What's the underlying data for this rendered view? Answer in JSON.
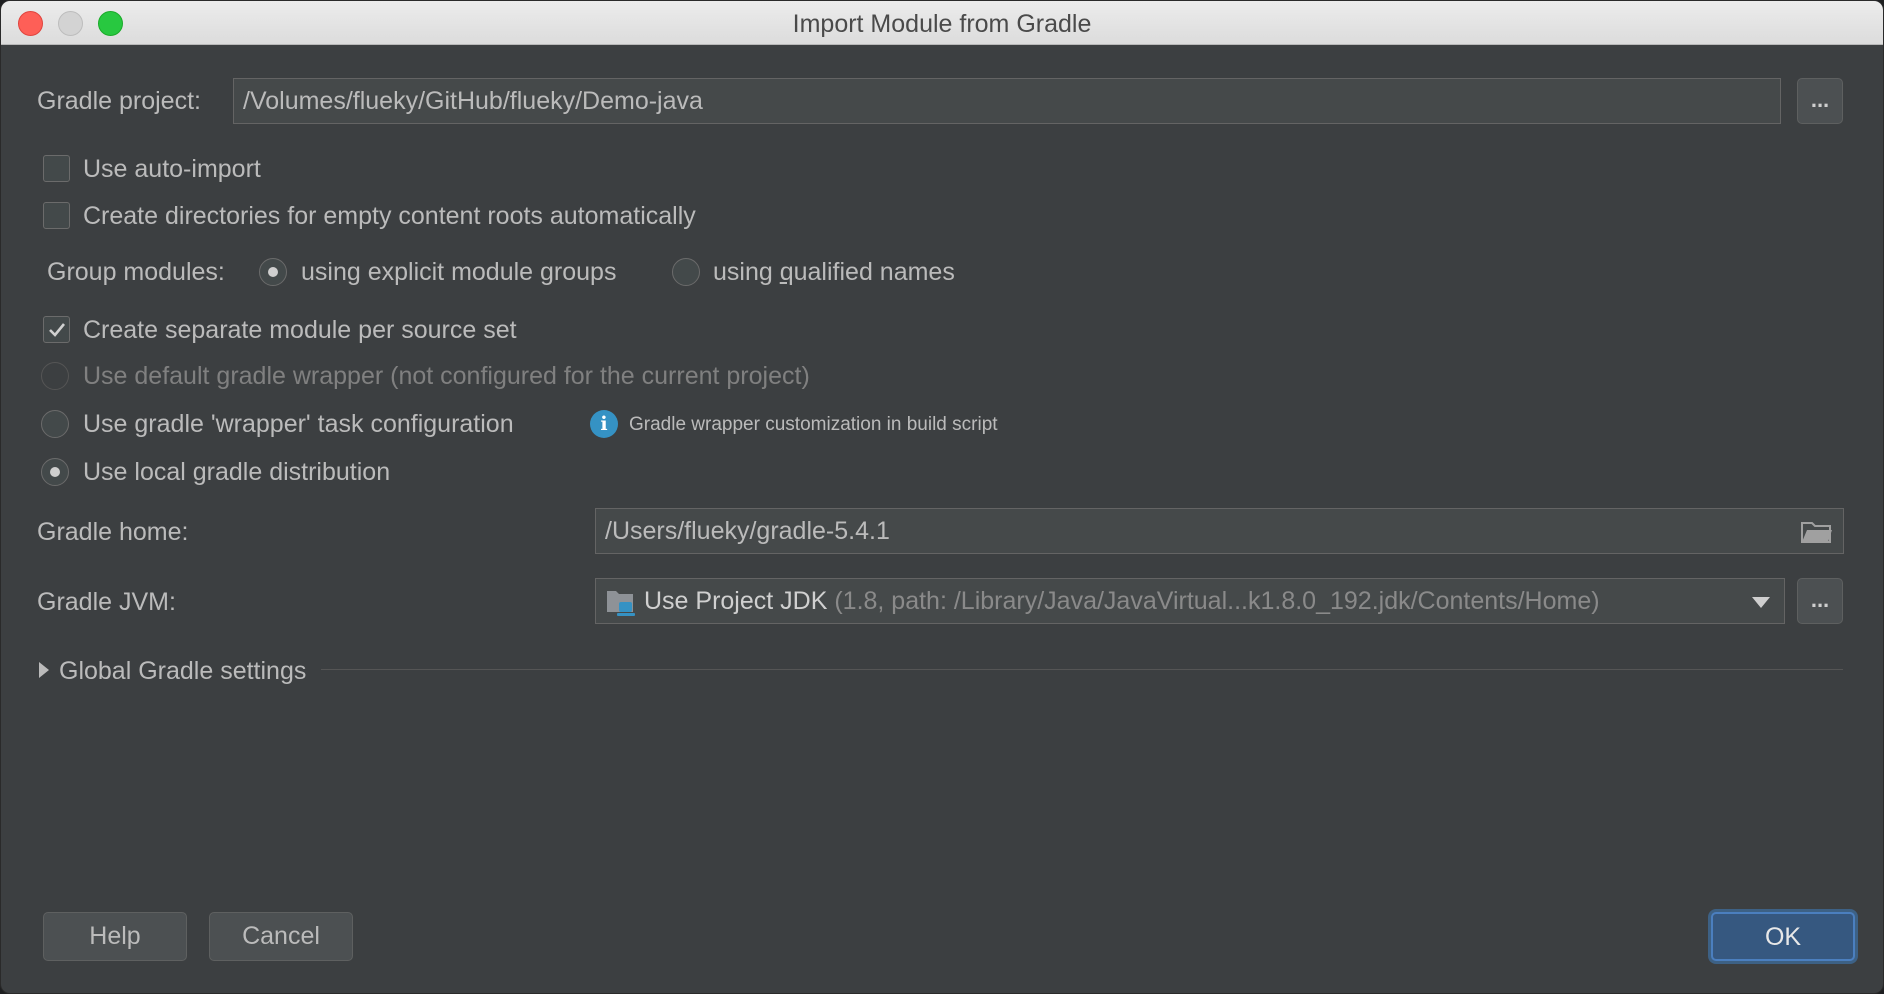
{
  "window": {
    "title": "Import Module from Gradle"
  },
  "gradle_project": {
    "label": "Gradle project:",
    "value": "/Volumes/flueky/GitHub/flueky/Demo-java",
    "browse_label": "..."
  },
  "options": {
    "auto_import": {
      "label": "Use auto-import",
      "checked": false
    },
    "create_dirs": {
      "label": "Create directories for empty content roots automatically",
      "checked": false
    },
    "group_modules": {
      "label": "Group modules:",
      "explicit_pre": "using explicit module ",
      "explicit_mn": "g",
      "explicit_post": "roups",
      "qualified_pre": "using ",
      "qualified_mn": "q",
      "qualified_post": "ualified names",
      "selected": "explicit"
    },
    "separate_module": {
      "label": "Create separate module per source set",
      "checked": true
    }
  },
  "distribution": {
    "default_wrapper": "Use default gradle wrapper (not configured for the current project)",
    "wrapper_task": "Use gradle 'wrapper' task configuration",
    "wrapper_hint": "Gradle wrapper customization in build script",
    "local": "Use local gradle distribution",
    "selected": "local"
  },
  "gradle_home": {
    "label": "Gradle home:",
    "value": "/Users/flueky/gradle-5.4.1"
  },
  "gradle_jvm": {
    "label": "Gradle JVM:",
    "main": "Use Project JDK",
    "detail": " (1.8, path: /Library/Java/JavaVirtual...k1.8.0_192.jdk/Contents/Home)",
    "browse_label": "..."
  },
  "global_settings": {
    "label": "Global Gradle settings"
  },
  "buttons": {
    "help": "Help",
    "cancel": "Cancel",
    "ok": "OK"
  },
  "colors": {
    "background": "#3c3f41",
    "accent": "#365880",
    "info": "#3592c4"
  },
  "icons": [
    "close-icon",
    "minimize-icon",
    "maximize-icon",
    "checkmark-icon",
    "info-icon",
    "folder-icon",
    "jdk-folder-icon",
    "chevron-down-icon",
    "triangle-right-icon"
  ]
}
